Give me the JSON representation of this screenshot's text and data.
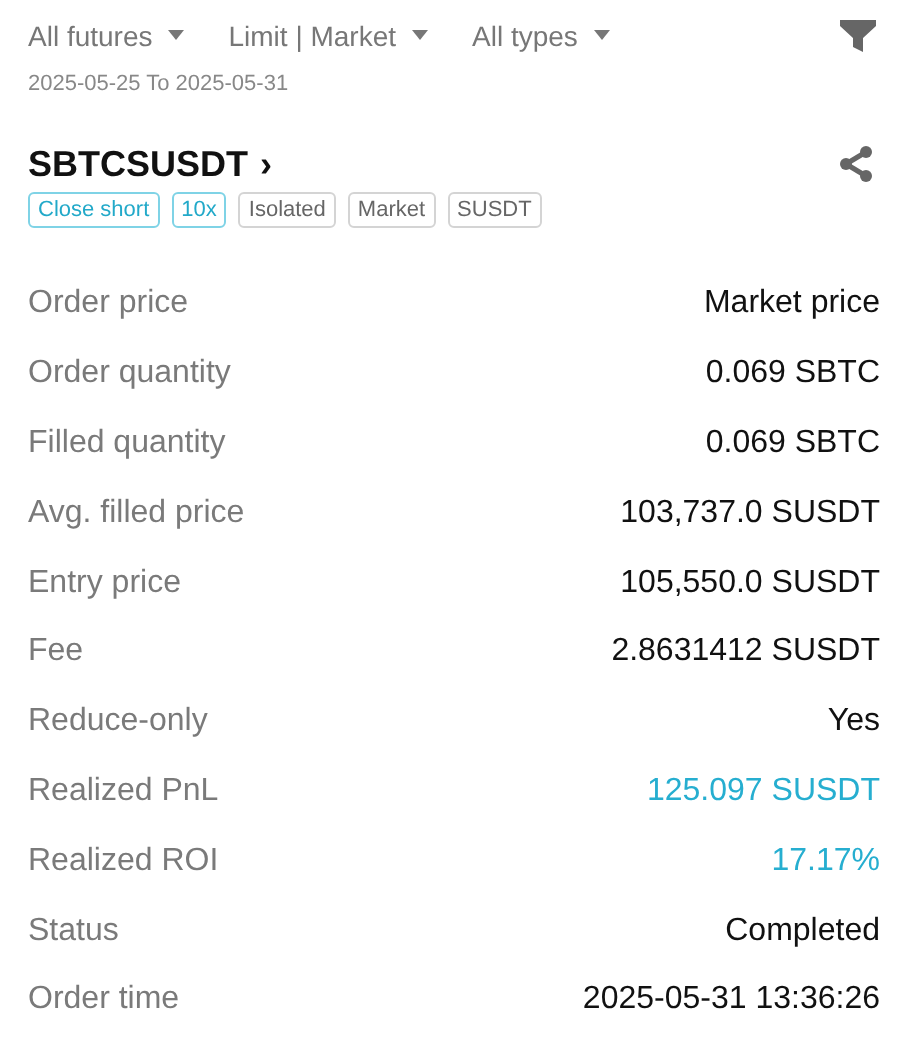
{
  "filters": [
    {
      "label": "All futures"
    },
    {
      "label": "Limit | Market"
    },
    {
      "label": "All types"
    }
  ],
  "date_range": "2025-05-25 To 2025-05-31",
  "symbol": "SBTCSUSDT",
  "chevron": "›",
  "tags": [
    {
      "label": "Close short",
      "kind": "accent"
    },
    {
      "label": "10x",
      "kind": "accent"
    },
    {
      "label": "Isolated",
      "kind": "plain"
    },
    {
      "label": "Market",
      "kind": "plain"
    },
    {
      "label": "SUSDT",
      "kind": "plain"
    }
  ],
  "details": [
    {
      "label": "Order price",
      "value": "Market price",
      "kind": "normal"
    },
    {
      "label": "Order quantity",
      "value": "0.069 SBTC",
      "kind": "normal"
    },
    {
      "label": "Filled quantity",
      "value": "0.069 SBTC",
      "kind": "normal"
    },
    {
      "label": "Avg. filled price",
      "value": "103,737.0 SUSDT",
      "kind": "normal"
    },
    {
      "label": "Entry price",
      "value": "105,550.0 SUSDT",
      "kind": "normal"
    },
    {
      "label": "Fee",
      "value": "2.8631412 SUSDT",
      "kind": "normal"
    },
    {
      "label": "Reduce-only",
      "value": "Yes",
      "kind": "normal"
    },
    {
      "label": "Realized PnL",
      "value": "125.097 SUSDT",
      "kind": "profit"
    },
    {
      "label": "Realized ROI",
      "value": "17.17%",
      "kind": "profit"
    },
    {
      "label": "Status",
      "value": "Completed",
      "kind": "normal"
    },
    {
      "label": "Order time",
      "value": "2025-05-31 13:36:26",
      "kind": "normal"
    }
  ]
}
